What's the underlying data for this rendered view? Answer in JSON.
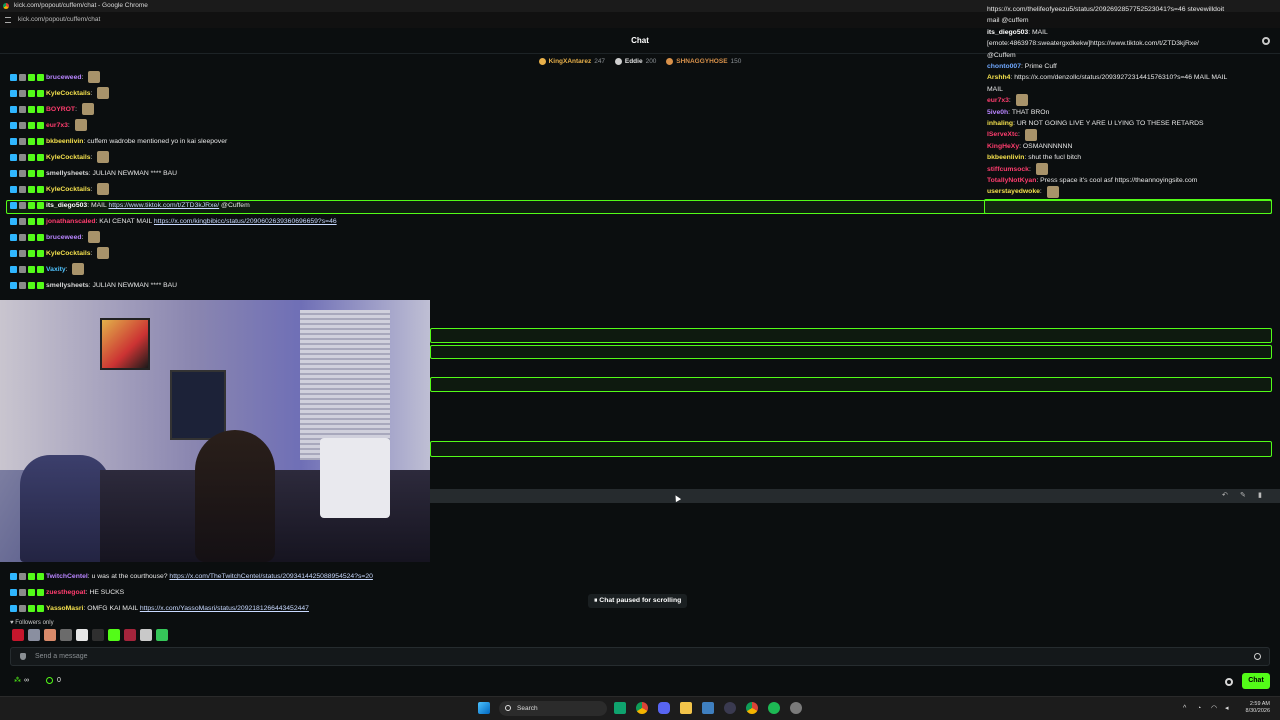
{
  "browser": {
    "title": "kick.com/popout/cuffem/chat - Google Chrome",
    "url": "kick.com/popout/cuffem/chat"
  },
  "header": {
    "title": "Chat"
  },
  "gifters": [
    {
      "name": "KingXAntarez",
      "count": "247",
      "color": "#e8b04a"
    },
    {
      "name": "Eddie",
      "count": "200",
      "color": "#cfcfcf"
    },
    {
      "name": "SHNAGGYHOSE",
      "count": "150",
      "color": "#d8914a"
    }
  ],
  "messages_left": [
    {
      "user": "bruceweed",
      "color": "#b985ff",
      "text": "",
      "link": ""
    },
    {
      "user": "KyleCocktails",
      "color": "#f4e04d",
      "text": "",
      "link": ""
    },
    {
      "user": "BOYROT",
      "color": "#ff3d6e",
      "text": "",
      "link": ""
    },
    {
      "user": "eur7x3",
      "color": "#ff3d6e",
      "text": "",
      "link": ""
    },
    {
      "user": "bkbeenlivin",
      "color": "#f4e04d",
      "text": "cuffem wadrobe mentioned yo in kai sleepover",
      "link": ""
    },
    {
      "user": "KyleCocktails",
      "color": "#f4e04d",
      "text": "",
      "link": ""
    },
    {
      "user": "smellysheets",
      "color": "#d7d7d7",
      "text": "JULIAN NEWMAN **** BAU",
      "link": ""
    },
    {
      "user": "KyleCocktails",
      "color": "#f4e04d",
      "text": "",
      "link": ""
    },
    {
      "user": "its_diego503",
      "color": "#ffffff",
      "text": "MAIL",
      "link": "https://www.tiktok.com/t/ZTD3kJRxe/",
      "after": "@Cuffem"
    },
    {
      "user": "jonathanscaled",
      "color": "#ff3d6e",
      "text": "KAI CENAT MAIL",
      "link": "https://x.com/kingbibicc/status/2090602639360696659?s=46"
    },
    {
      "user": "bruceweed",
      "color": "#b985ff",
      "text": "",
      "link": ""
    },
    {
      "user": "KyleCocktails",
      "color": "#f4e04d",
      "text": "",
      "link": ""
    },
    {
      "user": "Vaxity",
      "color": "#4fc3ff",
      "text": "",
      "link": ""
    },
    {
      "user": "smellysheets",
      "color": "#d7d7d7",
      "text": "JULIAN NEWMAN **** BAU",
      "link": ""
    }
  ],
  "messages_left_bottom": [
    {
      "user": "TwitchCentel",
      "color": "#b985ff",
      "text": "u was at the courthouse?",
      "link": "https://x.com/TheTwitchCentel/status/2093414425088954524?s=20"
    },
    {
      "user": "zuesthegoat",
      "color": "#ff3d6e",
      "text": "HE SUCKS",
      "link": ""
    },
    {
      "user": "YassoMasri",
      "color": "#f4e04d",
      "text": "OMFG KAI MAIL",
      "link": "https://x.com/YassoMasri/status/2092181266443452447"
    }
  ],
  "messages_right": [
    {
      "user": "",
      "color": "#ffffff",
      "text": "https://x.com/thelifeofyeezu5/status/2092692857752523041?s=46 stevewilldoit"
    },
    {
      "user": "",
      "color": "#ffffff",
      "text": "mail @cuffem"
    },
    {
      "user": "its_diego503",
      "color": "#ffffff",
      "text": "MAIL"
    },
    {
      "user": "",
      "color": "#ffffff",
      "text": "[emote:4863978:sweatergxdkekw]https://www.tiktok.com/t/ZTD3kjRxe/"
    },
    {
      "user": "",
      "color": "#ffffff",
      "text": "@Cuffem"
    },
    {
      "user": "chonto007",
      "color": "#6fa8ff",
      "text": "Prime Cuff"
    },
    {
      "user": "Arshh4",
      "color": "#f4e04d",
      "text": "https://x.com/denzollc/status/2093927231441576310?s=46 MAIL MAIL"
    },
    {
      "user": "",
      "color": "#ffffff",
      "text": "MAIL"
    },
    {
      "user": "eur7x3",
      "color": "#ff3d6e",
      "text": ""
    },
    {
      "user": "5ive0h",
      "color": "#b985ff",
      "text": "THAT BROn"
    },
    {
      "user": "inhaling",
      "color": "#f4e04d",
      "text": "UR NOT GOING LIVE Y ARE U LYING TO THESE RETARDS"
    },
    {
      "user": "IServeXtc",
      "color": "#ff3d6e",
      "text": ""
    },
    {
      "user": "KingHeXy",
      "color": "#ff3d6e",
      "text": "OSMANNNNNN"
    },
    {
      "user": "bkbeenlivin",
      "color": "#f4e04d",
      "text": "shut the fucl bitch"
    },
    {
      "user": "stiffcumsock",
      "color": "#ff3d6e",
      "text": ""
    },
    {
      "user": "TotallyNotKyan",
      "color": "#ff3d6e",
      "text": "Press space it's cool asf https://theannoyingsite.com"
    },
    {
      "user": "userstayedwoke",
      "color": "#f4e04d",
      "text": ""
    }
  ],
  "paused_label": "Chat paused for scrolling",
  "followers_only": "Followers only",
  "input": {
    "placeholder": "Send a message"
  },
  "bottom": {
    "infinity": "∞",
    "points": "0",
    "chat_button": "Chat"
  },
  "taskbar": {
    "search_label": "Search",
    "time": "2:59 AM",
    "date": "8/30/2026"
  },
  "accent": "#53fc18"
}
